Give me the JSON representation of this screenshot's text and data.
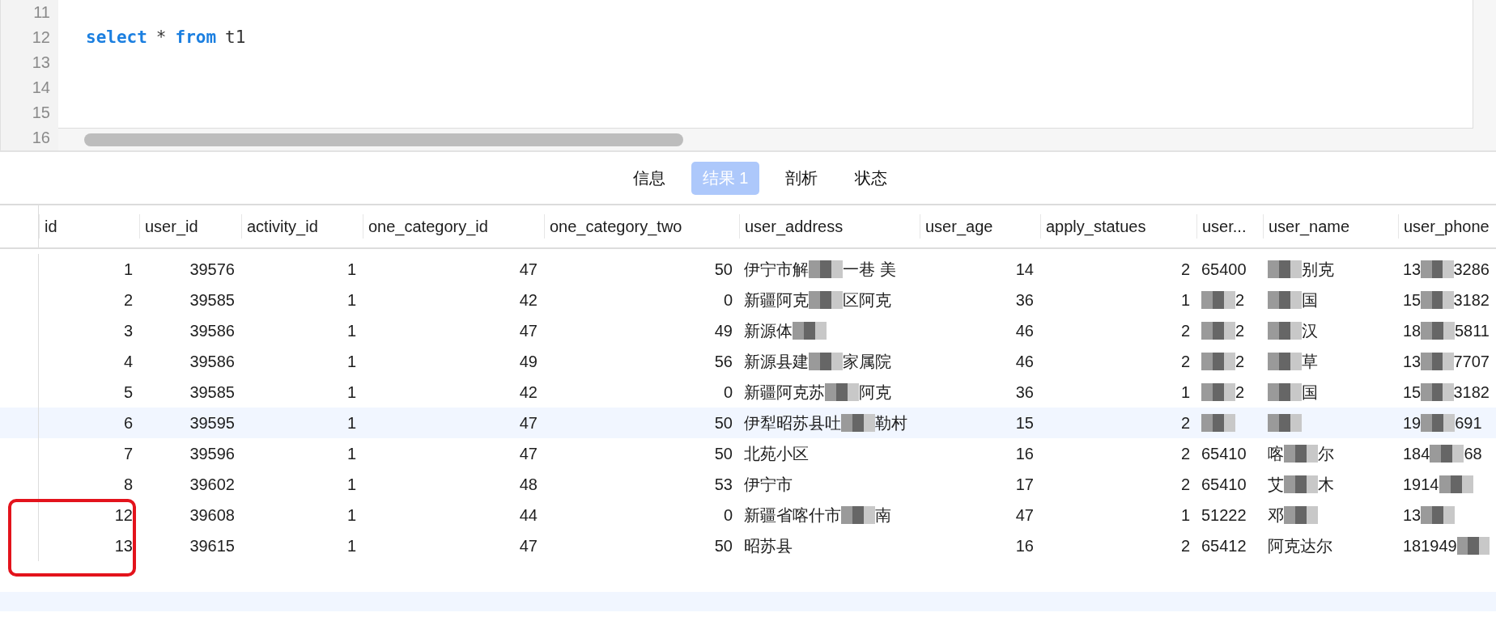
{
  "editor": {
    "lines": [
      {
        "number": "11"
      },
      {
        "number": "12",
        "tokens": [
          {
            "text": "select",
            "kind": "keyword"
          },
          {
            "text": "*",
            "kind": "plain"
          },
          {
            "text": "from",
            "kind": "keyword"
          },
          {
            "text": "t1",
            "kind": "plain"
          }
        ]
      },
      {
        "number": "13"
      },
      {
        "number": "14"
      },
      {
        "number": "15"
      },
      {
        "number": "16"
      }
    ]
  },
  "tabs": [
    {
      "label": "信息",
      "selected": false
    },
    {
      "label": "结果 1",
      "selected": true
    },
    {
      "label": "剖析",
      "selected": false
    },
    {
      "label": "状态",
      "selected": false
    }
  ],
  "table": {
    "columns": [
      {
        "label": "id",
        "kind": "number"
      },
      {
        "label": "user_id",
        "kind": "number"
      },
      {
        "label": "activity_id",
        "kind": "number"
      },
      {
        "label": "one_category_id",
        "kind": "number"
      },
      {
        "label": "one_category_two",
        "kind": "number"
      },
      {
        "label": "user_address",
        "kind": "text"
      },
      {
        "label": "user_age",
        "kind": "number"
      },
      {
        "label": "apply_statues",
        "kind": "number"
      },
      {
        "label": "user...",
        "kind": "text"
      },
      {
        "label": "user_name",
        "kind": "text"
      },
      {
        "label": "user_phone",
        "kind": "text"
      }
    ],
    "rows": [
      {
        "selected": false,
        "highlighted": false,
        "cells": [
          [
            "1"
          ],
          [
            "39576"
          ],
          [
            "1"
          ],
          [
            "47"
          ],
          [
            "50"
          ],
          [
            "伊宁市解",
            {
              "kind": "mosaic"
            },
            "一巷 美"
          ],
          [
            "14"
          ],
          [
            "2"
          ],
          [
            "65400"
          ],
          [
            {
              "kind": "mosaic"
            },
            "别克"
          ],
          [
            "13",
            {
              "kind": "mosaic"
            },
            "3286"
          ]
        ]
      },
      {
        "selected": false,
        "highlighted": false,
        "cells": [
          [
            "2"
          ],
          [
            "39585"
          ],
          [
            "1"
          ],
          [
            "42"
          ],
          [
            "0"
          ],
          [
            "新疆阿克",
            {
              "kind": "mosaic"
            },
            "区阿克"
          ],
          [
            "36"
          ],
          [
            "1"
          ],
          [
            {
              "kind": "mosaic"
            },
            "2"
          ],
          [
            {
              "kind": "mosaic"
            },
            "国"
          ],
          [
            "15",
            {
              "kind": "mosaic"
            },
            "3182"
          ]
        ]
      },
      {
        "selected": false,
        "highlighted": false,
        "cells": [
          [
            "3"
          ],
          [
            "39586"
          ],
          [
            "1"
          ],
          [
            "47"
          ],
          [
            "49"
          ],
          [
            "新源体",
            {
              "kind": "mosaic"
            }
          ],
          [
            "46"
          ],
          [
            "2"
          ],
          [
            {
              "kind": "mosaic"
            },
            "2"
          ],
          [
            {
              "kind": "mosaic"
            },
            "汉"
          ],
          [
            "18",
            {
              "kind": "mosaic"
            },
            "5811"
          ]
        ]
      },
      {
        "selected": false,
        "highlighted": false,
        "cells": [
          [
            "4"
          ],
          [
            "39586"
          ],
          [
            "1"
          ],
          [
            "49"
          ],
          [
            "56"
          ],
          [
            "新源县建",
            {
              "kind": "mosaic"
            },
            "家属院"
          ],
          [
            "46"
          ],
          [
            "2"
          ],
          [
            {
              "kind": "mosaic"
            },
            "2"
          ],
          [
            {
              "kind": "mosaic"
            },
            "草"
          ],
          [
            "13",
            {
              "kind": "mosaic"
            },
            "7707"
          ]
        ]
      },
      {
        "selected": false,
        "highlighted": false,
        "cells": [
          [
            "5"
          ],
          [
            "39585"
          ],
          [
            "1"
          ],
          [
            "42"
          ],
          [
            "0"
          ],
          [
            "新疆阿克苏",
            {
              "kind": "mosaic"
            },
            "阿克"
          ],
          [
            "36"
          ],
          [
            "1"
          ],
          [
            {
              "kind": "mosaic"
            },
            "2"
          ],
          [
            {
              "kind": "mosaic"
            },
            "国"
          ],
          [
            "15",
            {
              "kind": "mosaic"
            },
            "3182"
          ]
        ]
      },
      {
        "selected": true,
        "highlighted": false,
        "cells": [
          [
            "6"
          ],
          [
            "39595"
          ],
          [
            "1"
          ],
          [
            "47"
          ],
          [
            "50"
          ],
          [
            "伊犁昭苏县吐",
            {
              "kind": "mosaic"
            },
            "勒村"
          ],
          [
            "15"
          ],
          [
            "2"
          ],
          [
            {
              "kind": "mosaic"
            }
          ],
          [
            {
              "kind": "mosaic"
            }
          ],
          [
            "19",
            {
              "kind": "mosaic"
            },
            "691"
          ]
        ]
      },
      {
        "selected": false,
        "highlighted": false,
        "cells": [
          [
            "7"
          ],
          [
            "39596"
          ],
          [
            "1"
          ],
          [
            "47"
          ],
          [
            "50"
          ],
          [
            "北苑小区"
          ],
          [
            "16"
          ],
          [
            "2"
          ],
          [
            "65410"
          ],
          [
            "喀",
            {
              "kind": "mosaic"
            },
            "尔"
          ],
          [
            "184",
            {
              "kind": "mosaic"
            },
            "68"
          ]
        ]
      },
      {
        "selected": false,
        "highlighted": false,
        "cells": [
          [
            "8"
          ],
          [
            "39602"
          ],
          [
            "1"
          ],
          [
            "48"
          ],
          [
            "53"
          ],
          [
            "伊宁市"
          ],
          [
            "17"
          ],
          [
            "2"
          ],
          [
            "65410"
          ],
          [
            "艾",
            {
              "kind": "mosaic"
            },
            "木"
          ],
          [
            "1914",
            {
              "kind": "mosaic"
            }
          ]
        ]
      },
      {
        "selected": false,
        "highlighted": true,
        "cells": [
          [
            "12"
          ],
          [
            "39608"
          ],
          [
            "1"
          ],
          [
            "44"
          ],
          [
            "0"
          ],
          [
            "新疆省喀什市",
            {
              "kind": "mosaic"
            },
            "南"
          ],
          [
            "47"
          ],
          [
            "1"
          ],
          [
            "51222"
          ],
          [
            "邓",
            {
              "kind": "mosaic"
            }
          ],
          [
            "13",
            {
              "kind": "mosaic"
            }
          ]
        ]
      },
      {
        "selected": false,
        "highlighted": true,
        "cells": [
          [
            "13"
          ],
          [
            "39615"
          ],
          [
            "1"
          ],
          [
            "47"
          ],
          [
            "50"
          ],
          [
            "昭苏县"
          ],
          [
            "16"
          ],
          [
            "2"
          ],
          [
            "65412"
          ],
          [
            "阿克达尔"
          ],
          [
            "181949",
            {
              "kind": "mosaic"
            }
          ]
        ]
      }
    ]
  }
}
